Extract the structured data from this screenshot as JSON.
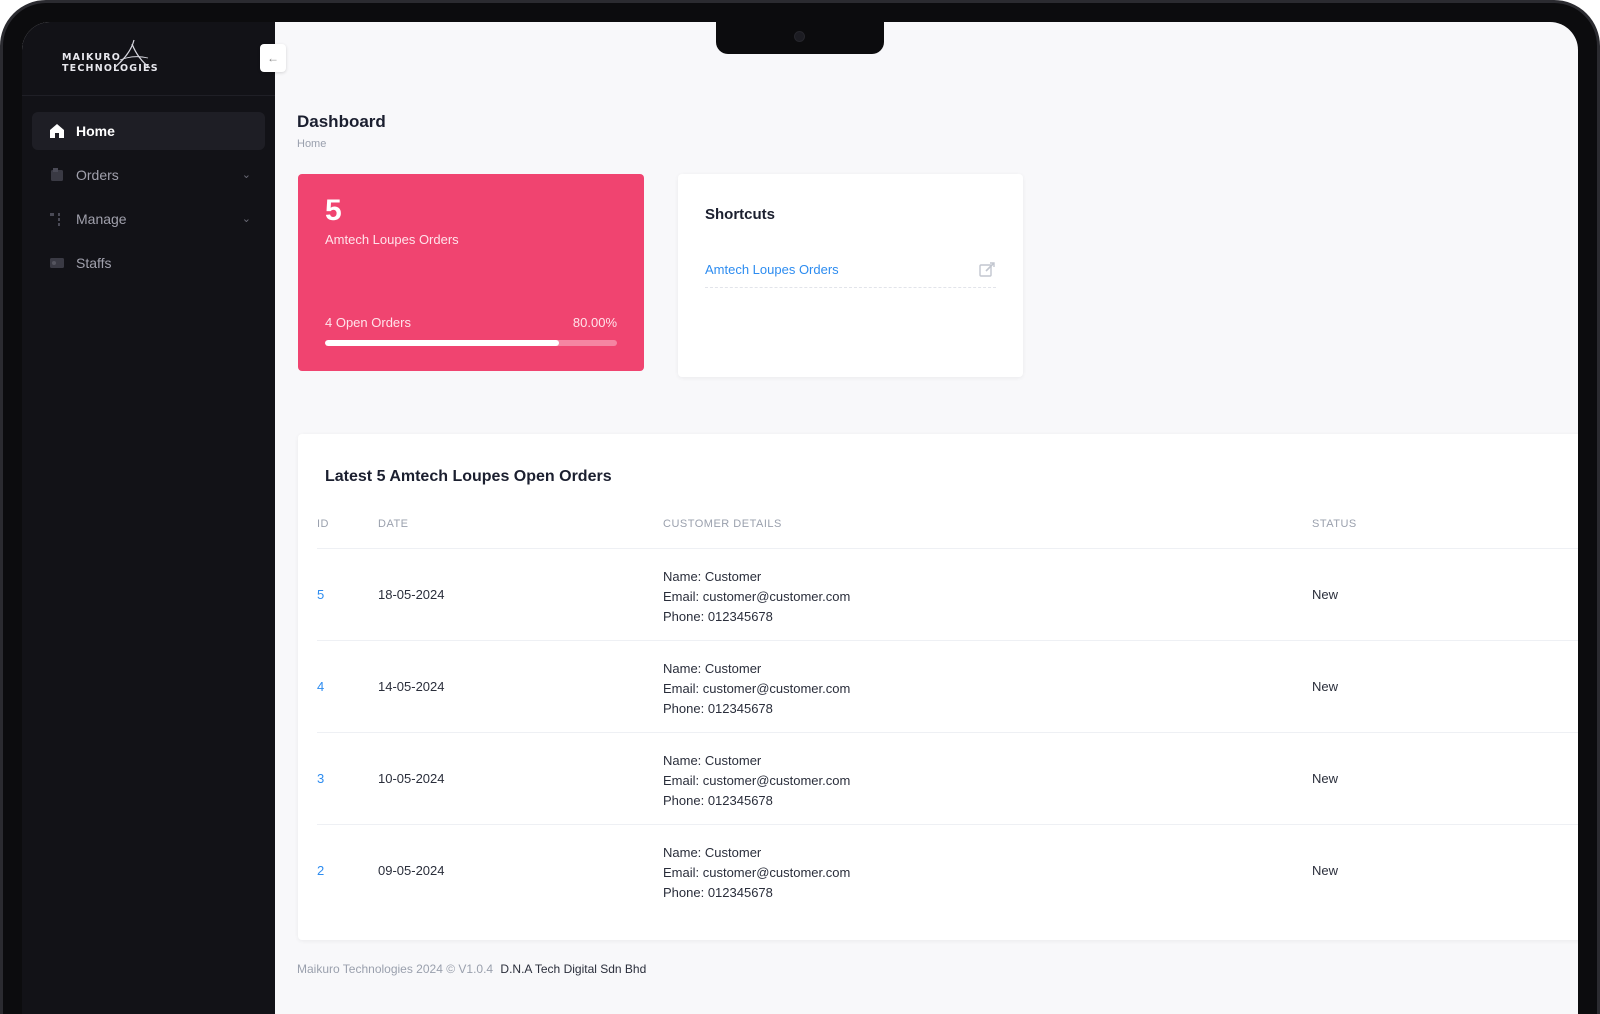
{
  "sidebar": {
    "logo_line1": "MAIKURO",
    "logo_line2": "TECHNOLOGIES",
    "collapse_icon": "arrow-left-icon",
    "items": [
      {
        "label": "Home",
        "icon": "home-icon",
        "active": true
      },
      {
        "label": "Orders",
        "icon": "orders-icon",
        "expandable": true
      },
      {
        "label": "Manage",
        "icon": "manage-icon",
        "expandable": true
      },
      {
        "label": "Staffs",
        "icon": "staffs-icon"
      }
    ]
  },
  "header": {
    "title": "Dashboard",
    "breadcrumb": "Home"
  },
  "stat_card": {
    "count": "5",
    "label": "Amtech Loupes Orders",
    "open_label": "4 Open Orders",
    "percent_label": "80.00%",
    "progress": 0.8,
    "color": "#f04470"
  },
  "shortcuts": {
    "title": "Shortcuts",
    "items": [
      {
        "label": "Amtech Loupes Orders",
        "icon": "external-edit-icon"
      }
    ]
  },
  "orders_table": {
    "title": "Latest 5 Amtech Loupes Open Orders",
    "columns": [
      "ID",
      "DATE",
      "CUSTOMER DETAILS",
      "STATUS"
    ],
    "rows": [
      {
        "id": "5",
        "date": "18-05-2024",
        "name": "Name: Customer",
        "email": "Email: customer@customer.com",
        "phone": "Phone: 012345678",
        "status": "New"
      },
      {
        "id": "4",
        "date": "14-05-2024",
        "name": "Name: Customer",
        "email": "Email: customer@customer.com",
        "phone": "Phone: 012345678",
        "status": "New"
      },
      {
        "id": "3",
        "date": "10-05-2024",
        "name": "Name: Customer",
        "email": "Email: customer@customer.com",
        "phone": "Phone: 012345678",
        "status": "New"
      },
      {
        "id": "2",
        "date": "09-05-2024",
        "name": "Name: Customer",
        "email": "Email: customer@customer.com",
        "phone": "Phone: 012345678",
        "status": "New"
      }
    ]
  },
  "footer": {
    "text": "Maikuro Technologies 2024 © V1.0.4",
    "brand": "D.N.A Tech Digital Sdn Bhd"
  },
  "colors": {
    "accent": "#f04470",
    "link": "#2d8cf0",
    "sidebar_bg": "#121217"
  }
}
